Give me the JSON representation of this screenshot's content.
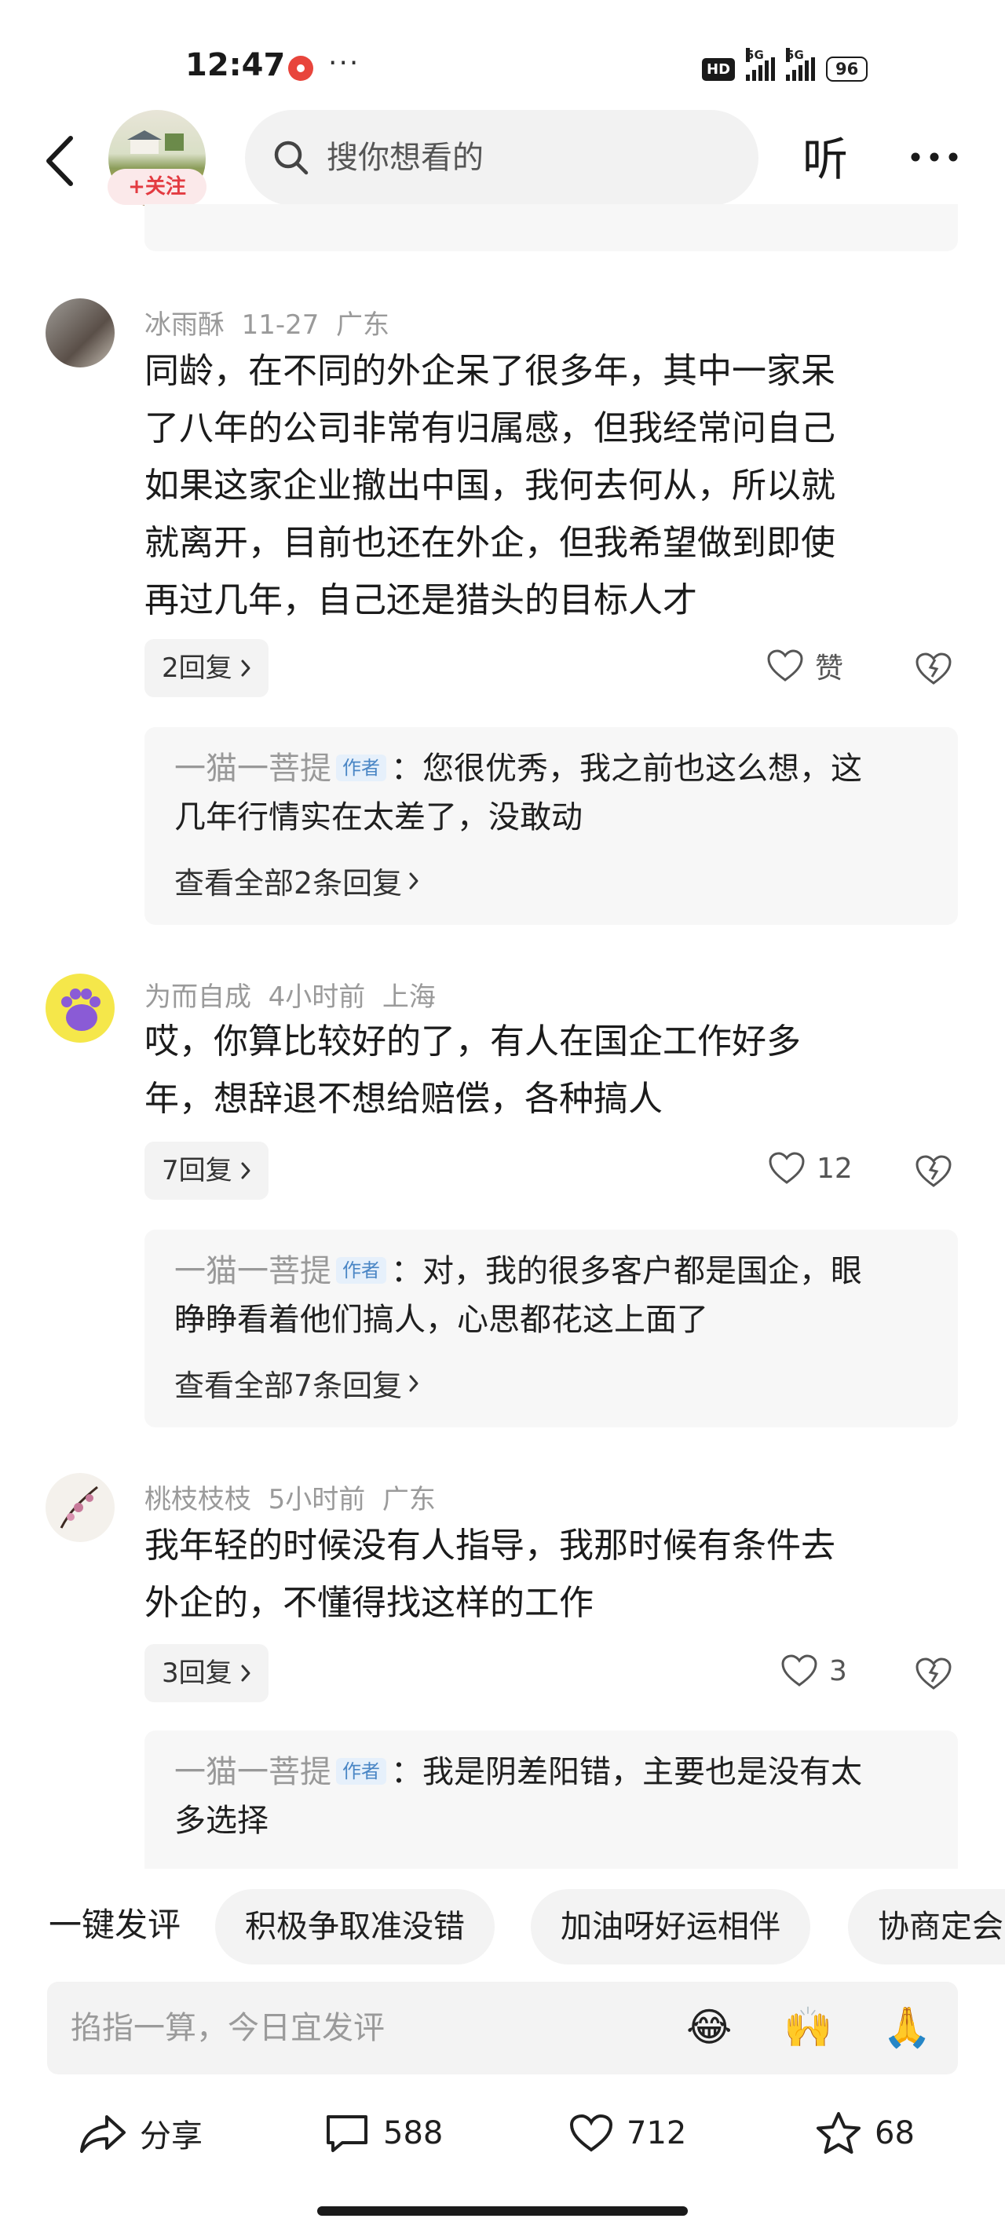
{
  "status_bar": {
    "time": "12:47",
    "dots": "···",
    "hd_label": "HD",
    "net_1": "5G",
    "net_2": "5G",
    "battery": "96"
  },
  "top_nav": {
    "follow_label": "+关注",
    "search_placeholder": "搜你想看的",
    "listen_label": "听"
  },
  "comments": [
    {
      "user": "冰雨酥",
      "date": "11-27",
      "region": "广东",
      "lines": [
        "同龄，在不同的外企呆了很多年，其中一家呆",
        "了八年的公司非常有归属感，但我经常问自己",
        "如果这家企业撤出中国，我何去何从，所以就",
        "就离开，目前也还在外企，但我希望做到即使",
        "再过几年，自己还是猎头的目标人才"
      ],
      "reply_count": "2回复",
      "likes": "赞",
      "author_reply": {
        "name": "一猫一菩提",
        "tag": "作者",
        "line1": "：您很优秀，我之前也这么想，这",
        "line2": "几年行情实在太差了，没敢动",
        "view_all": "查看全部2条回复"
      }
    },
    {
      "user": "为而自成",
      "date": "4小时前",
      "region": "上海",
      "lines": [
        "哎，你算比较好的了，有人在国企工作好多",
        "年，想辞退不想给赔偿，各种搞人"
      ],
      "reply_count": "7回复",
      "likes": "12",
      "author_reply": {
        "name": "一猫一菩提",
        "tag": "作者",
        "line1": "：对，我的很多客户都是国企，眼",
        "line2": "睁睁看着他们搞人，心思都花这上面了",
        "view_all": "查看全部7条回复"
      }
    },
    {
      "user": "桃枝枝枝",
      "date": "5小时前",
      "region": "广东",
      "lines": [
        "我年轻的时候没有人指导，我那时候有条件去",
        "外企的，不懂得找这样的工作"
      ],
      "reply_count": "3回复",
      "likes": "3",
      "author_reply": {
        "name": "一猫一菩提",
        "tag": "作者",
        "line1": "：我是阴差阳错，主要也是没有太",
        "line2": "多选择"
      }
    }
  ],
  "quick_comments": {
    "label": "一键发评",
    "chips": [
      "积极争取准没错",
      "加油呀好运相伴",
      "协商定会"
    ]
  },
  "input": {
    "placeholder": "掐指一算，今日宜发评",
    "emojis": [
      "😂",
      "🙌",
      "🙏"
    ]
  },
  "bottom_bar": {
    "share_label": "分享",
    "comment_count": "588",
    "like_count": "712",
    "fav_count": "68"
  }
}
